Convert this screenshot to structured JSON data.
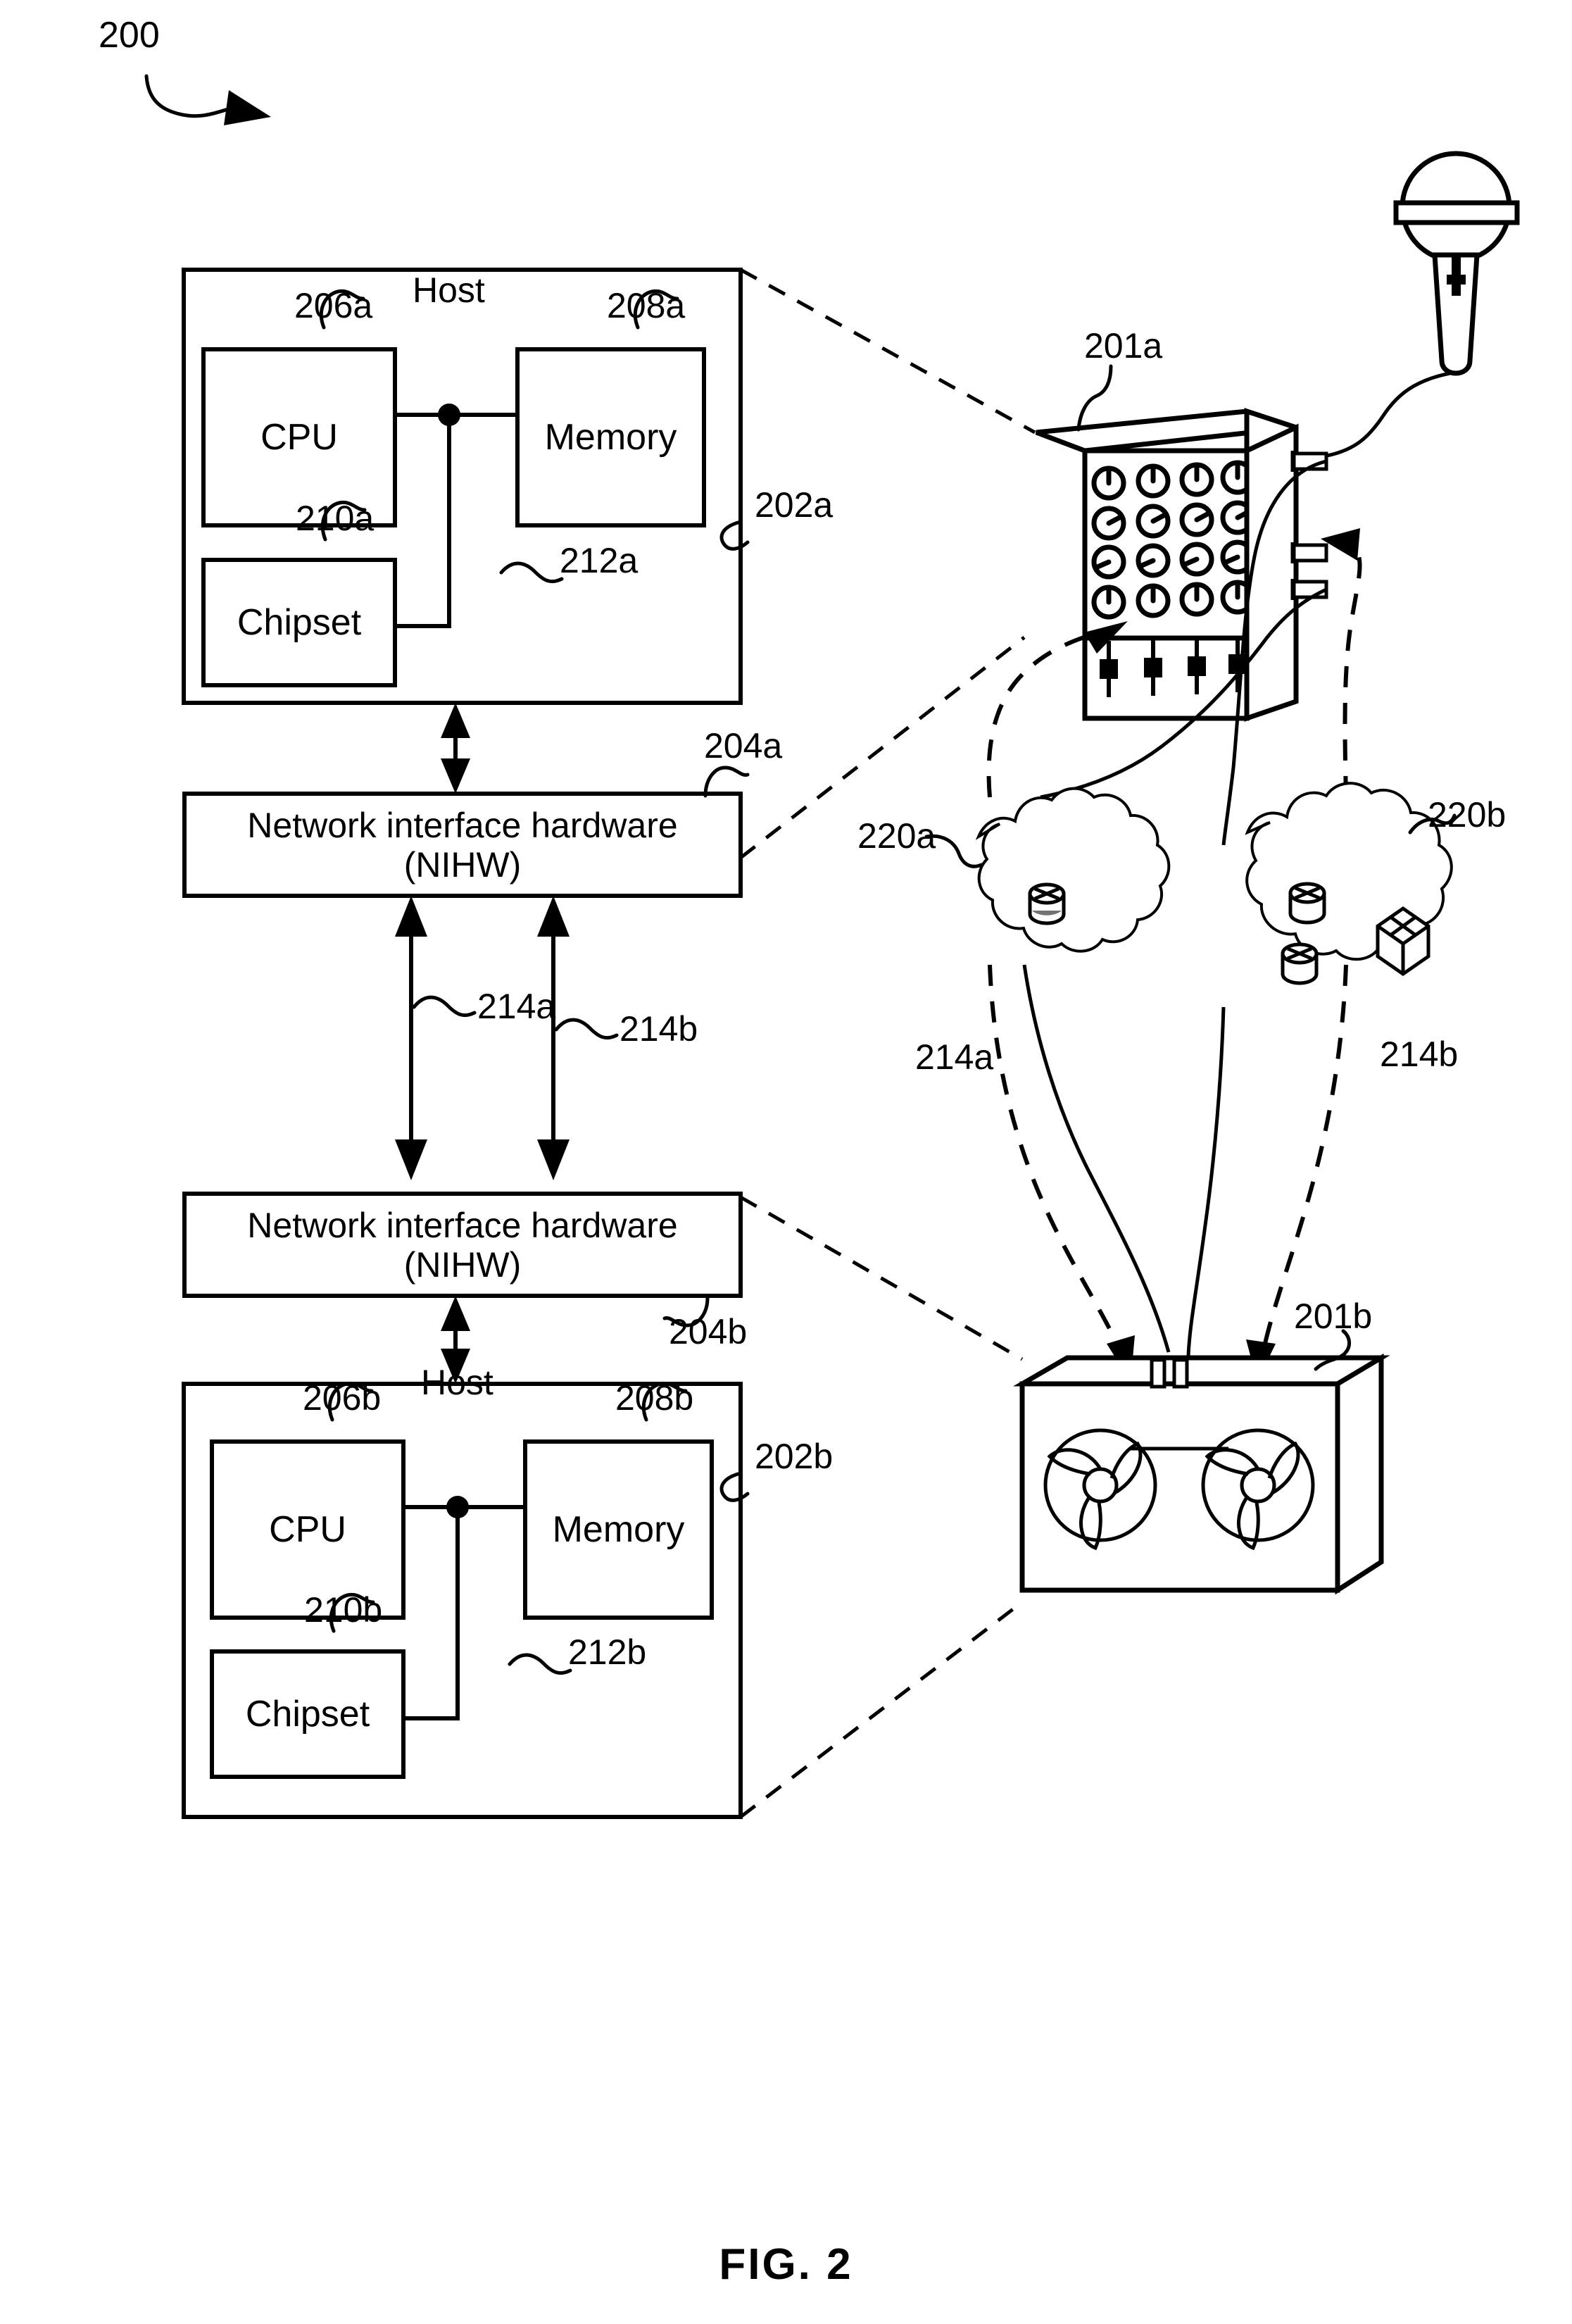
{
  "figure": {
    "number_label": "200",
    "caption": "FIG. 2"
  },
  "hosts": [
    {
      "id": "host-a",
      "title": "Host",
      "enclosure_ref": "202a",
      "cpu": {
        "label": "CPU",
        "ref": "206a"
      },
      "memory": {
        "label": "Memory",
        "ref": "208a"
      },
      "chipset": {
        "label": "Chipset",
        "ref": "210a"
      },
      "bus_ref": "212a"
    },
    {
      "id": "host-b",
      "title": "Host",
      "enclosure_ref": "202b",
      "cpu": {
        "label": "CPU",
        "ref": "206b"
      },
      "memory": {
        "label": "Memory",
        "ref": "208b"
      },
      "chipset": {
        "label": "Chipset",
        "ref": "210b"
      },
      "bus_ref": "212b"
    }
  ],
  "nihw": [
    {
      "id": "nihw-a",
      "line1": "Network interface hardware",
      "line2": "(NIHW)",
      "ref": "204a"
    },
    {
      "id": "nihw-b",
      "line1": "Network interface hardware",
      "line2": "(NIHW)",
      "ref": "204b"
    }
  ],
  "links": [
    {
      "id": "link-a",
      "ref": "214a"
    },
    {
      "id": "link-b",
      "ref": "214b"
    }
  ],
  "network_link_refs": [
    {
      "id": "net-link-a",
      "ref": "214a"
    },
    {
      "id": "net-link-b",
      "ref": "214b"
    }
  ],
  "devices": [
    {
      "id": "mixer",
      "ref": "201a",
      "kind": "audio-mixer-console",
      "knob_rows": 4,
      "knob_cols": 4,
      "slider_count": 4,
      "jack_count": 3
    },
    {
      "id": "speaker",
      "ref": "201b",
      "kind": "loudspeaker-cabinet",
      "driver_count": 2,
      "jack_count": 2
    }
  ],
  "microphone": {
    "id": "microphone",
    "kind": "handheld-microphone"
  },
  "clouds": [
    {
      "id": "cloud-a",
      "ref": "220a",
      "nodes": [
        {
          "icon": "router-icon"
        }
      ]
    },
    {
      "id": "cloud-b",
      "ref": "220b",
      "nodes": [
        {
          "icon": "router-icon"
        },
        {
          "icon": "router-icon"
        },
        {
          "icon": "switch-icon"
        }
      ]
    }
  ],
  "colors": {
    "ink": "#000000",
    "paper": "#ffffff"
  }
}
